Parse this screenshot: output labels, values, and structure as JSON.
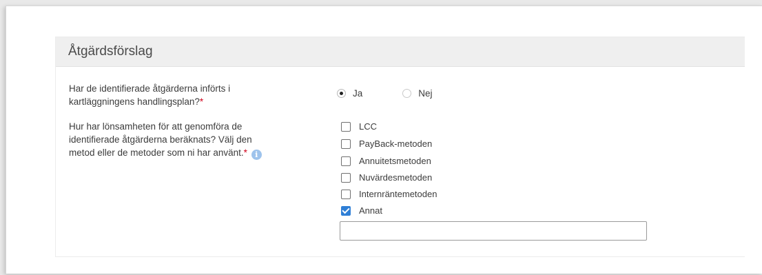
{
  "section": {
    "title": "Åtgärdsförslag"
  },
  "question1": {
    "line1": "Har de identifierade åtgärderna införts i",
    "line2": "kartläggningens handlingsplan?",
    "required": "*",
    "options": [
      {
        "label": "Ja",
        "selected": true
      },
      {
        "label": "Nej",
        "selected": false
      }
    ]
  },
  "question2": {
    "line1": "Hur har lönsamheten för att genomföra de",
    "line2": "identifierade åtgärderna beräknats? Välj den",
    "line3": "metod eller de metoder som ni har använt.",
    "required": "*",
    "info_icon": "info-icon",
    "options": [
      {
        "label": "LCC",
        "checked": false
      },
      {
        "label": "PayBack-metoden",
        "checked": false
      },
      {
        "label": "Annuitetsmetoden",
        "checked": false
      },
      {
        "label": "Nuvärdesmetoden",
        "checked": false
      },
      {
        "label": "Internräntemetoden",
        "checked": false
      },
      {
        "label": "Annat",
        "checked": true
      }
    ],
    "other_value": ""
  },
  "colors": {
    "required": "#d0021b",
    "checkbox_checked": "#2f7fd6",
    "info_icon": "#9ec3ec",
    "header_bg": "#efefef"
  }
}
